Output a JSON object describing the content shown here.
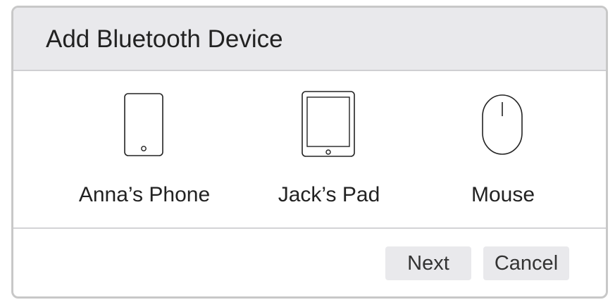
{
  "dialog": {
    "title": "Add Bluetooth Device"
  },
  "devices": [
    {
      "label": "Anna’s Phone",
      "icon": "phone-icon"
    },
    {
      "label": "Jack’s Pad",
      "icon": "tablet-icon"
    },
    {
      "label": "Mouse",
      "icon": "mouse-icon"
    }
  ],
  "buttons": {
    "next_label": "Next",
    "cancel_label": "Cancel"
  },
  "colors": {
    "header_background": "#e9e9ec",
    "border": "#c8c8c8",
    "button_background": "#e9e9ec",
    "text": "#222222"
  }
}
